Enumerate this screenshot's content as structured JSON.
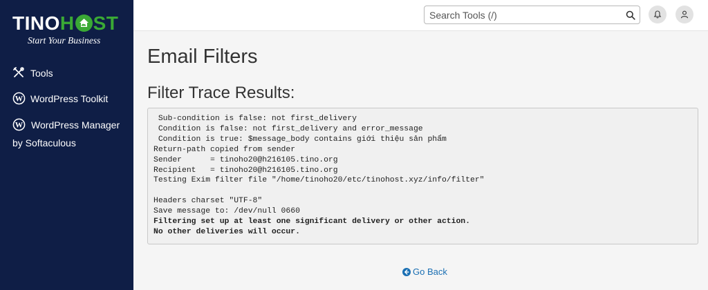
{
  "brand": {
    "name_part1": "TINO",
    "name_h": "H",
    "name_part2": "ST",
    "slogan": "Start Your Business"
  },
  "sidebar": {
    "items": [
      {
        "label": "Tools",
        "icon": "tools-icon"
      },
      {
        "label": "WordPress Toolkit",
        "icon": "wordpress-icon"
      },
      {
        "label": "WordPress Manager",
        "sub": "by Softaculous",
        "icon": "wordpress-icon"
      }
    ]
  },
  "topbar": {
    "search_placeholder": "Search Tools (/)"
  },
  "main": {
    "page_title": "Email Filters",
    "section_title": "Filter Trace Results:",
    "trace_lines": [
      {
        "text": " Sub-condition is false: not first_delivery",
        "bold": false
      },
      {
        "text": " Condition is false: not first_delivery and error_message",
        "bold": false
      },
      {
        "text": " Condition is true: $message_body contains giới thiệu sản phẩm",
        "bold": false
      },
      {
        "text": "Return-path copied from sender",
        "bold": false
      },
      {
        "text": "Sender      = tinoho20@h216105.tino.org",
        "bold": false
      },
      {
        "text": "Recipient   = tinoho20@h216105.tino.org",
        "bold": false
      },
      {
        "text": "Testing Exim filter file \"/home/tinoho20/etc/tinohost.xyz/info/filter\"",
        "bold": false
      },
      {
        "text": "",
        "bold": false
      },
      {
        "text": "Headers charset \"UTF-8\"",
        "bold": false
      },
      {
        "text": "Save message to: /dev/null 0660",
        "bold": false
      },
      {
        "text": "Filtering set up at least one significant delivery or other action.",
        "bold": true
      },
      {
        "text": "No other deliveries will occur.",
        "bold": true
      }
    ],
    "back_label": "Go Back"
  },
  "colors": {
    "sidebar_bg": "#0f1e46",
    "brand_green": "#3aa935",
    "link_blue": "#1a6fb3"
  }
}
